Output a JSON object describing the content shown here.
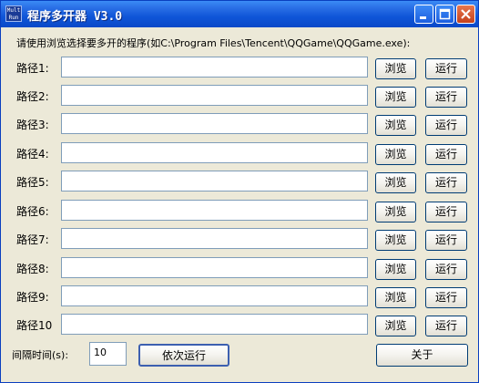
{
  "window": {
    "title": "程序多开器 V3.0",
    "icon_text_top": "Mult",
    "icon_text_bottom": "Run",
    "icon": "app-icon"
  },
  "instruction": "请使用浏览选择要多开的程序(如C:\\Program Files\\Tencent\\QQGame\\QQGame.exe):",
  "rows": [
    {
      "label": "路径1:",
      "value": "",
      "browse": "浏览",
      "run": "运行"
    },
    {
      "label": "路径2:",
      "value": "",
      "browse": "浏览",
      "run": "运行"
    },
    {
      "label": "路径3:",
      "value": "",
      "browse": "浏览",
      "run": "运行"
    },
    {
      "label": "路径4:",
      "value": "",
      "browse": "浏览",
      "run": "运行"
    },
    {
      "label": "路径5:",
      "value": "",
      "browse": "浏览",
      "run": "运行"
    },
    {
      "label": "路径6:",
      "value": "",
      "browse": "浏览",
      "run": "运行"
    },
    {
      "label": "路径7:",
      "value": "",
      "browse": "浏览",
      "run": "运行"
    },
    {
      "label": "路径8:",
      "value": "",
      "browse": "浏览",
      "run": "运行"
    },
    {
      "label": "路径9:",
      "value": "",
      "browse": "浏览",
      "run": "运行"
    },
    {
      "label": "路径10",
      "value": "",
      "browse": "浏览",
      "run": "运行"
    }
  ],
  "bottom": {
    "interval_label": "间隔时间(s):",
    "interval_value": "10",
    "run_sequential": "依次运行",
    "about": "关于"
  }
}
